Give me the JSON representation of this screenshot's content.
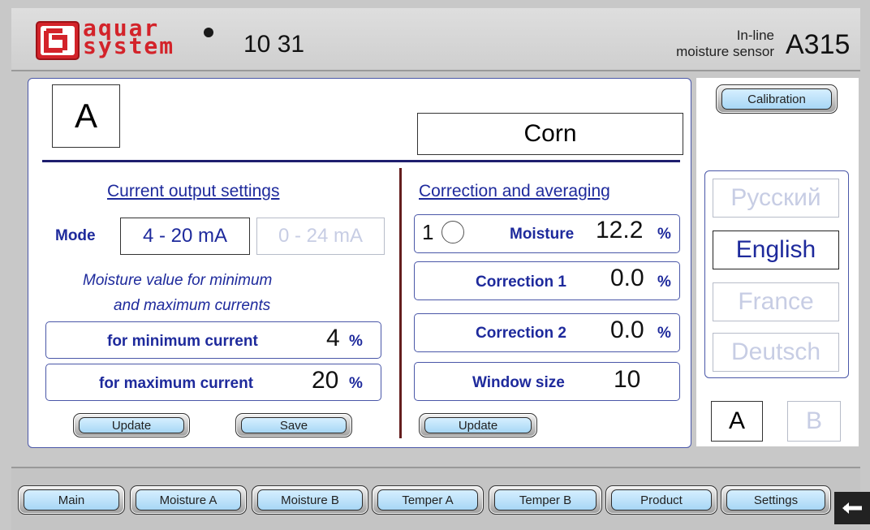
{
  "header": {
    "brand_line1": "aquar",
    "brand_line2": "system",
    "time": "10 31",
    "sensor_label_line1": "In-line",
    "sensor_label_line2": "moisture sensor",
    "model": "A315"
  },
  "main": {
    "channel": "A",
    "product": "Corn"
  },
  "current_output": {
    "title": "Current output settings",
    "mode_label": "Mode",
    "mode_option_1": "4 - 20 mA",
    "mode_option_2": "0 - 24 mA",
    "desc_line1": "Moisture value for minimum",
    "desc_line2": "and maximum currents",
    "min_label": "for minimum current",
    "min_value": "4",
    "max_label": "for maximum current",
    "max_value": "20",
    "unit": "%",
    "update_label": "Update",
    "save_label": "Save"
  },
  "correction": {
    "title": "Correction and averaging",
    "index": "1",
    "moisture_label": "Moisture",
    "moisture_value": "12.2",
    "correction1_label": "Correction 1",
    "correction1_value": "0.0",
    "correction2_label": "Correction 2",
    "correction2_value": "0.0",
    "window_label": "Window size",
    "window_value": "10",
    "unit": "%",
    "update_label": "Update"
  },
  "side": {
    "calibration_label": "Calibration",
    "languages": [
      "Русский",
      "English",
      "France",
      "Deutsch"
    ],
    "channel_a": "A",
    "channel_b": "B"
  },
  "nav": {
    "items": [
      "Main",
      "Moisture A",
      "Moisture B",
      "Temper A",
      "Temper B",
      "Product",
      "Settings"
    ]
  }
}
